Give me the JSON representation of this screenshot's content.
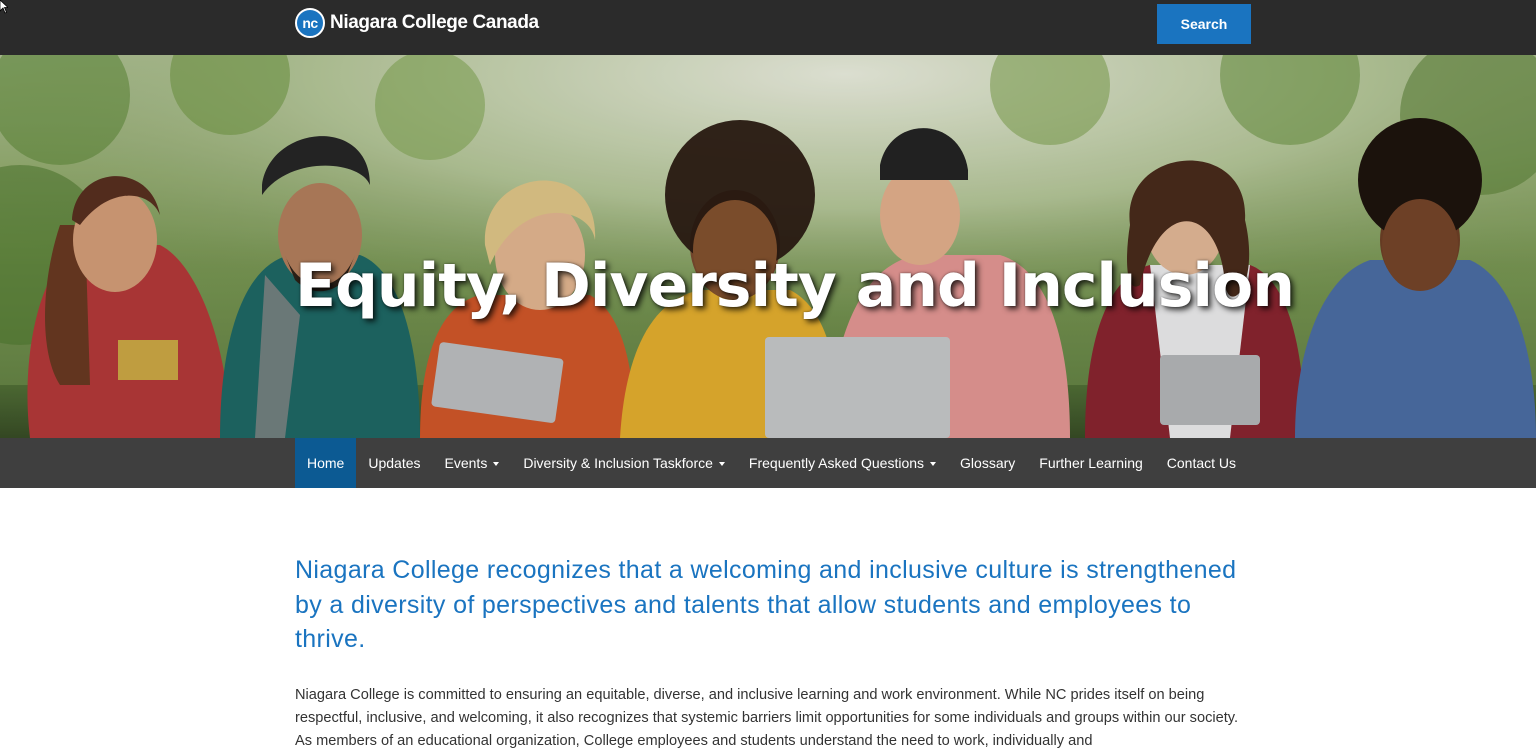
{
  "header": {
    "logo_badge": "nc",
    "logo_text": "Niagara College Canada",
    "search_label": "Search"
  },
  "hero": {
    "title": "Equity, Diversity and Inclusion"
  },
  "nav": {
    "items": [
      {
        "label": "Home",
        "active": true,
        "dropdown": false
      },
      {
        "label": "Updates",
        "active": false,
        "dropdown": false
      },
      {
        "label": "Events",
        "active": false,
        "dropdown": true
      },
      {
        "label": "Diversity & Inclusion Taskforce",
        "active": false,
        "dropdown": true
      },
      {
        "label": "Frequently Asked Questions",
        "active": false,
        "dropdown": true
      },
      {
        "label": "Glossary",
        "active": false,
        "dropdown": false
      },
      {
        "label": "Further Learning",
        "active": false,
        "dropdown": false
      },
      {
        "label": "Contact Us",
        "active": false,
        "dropdown": false
      }
    ]
  },
  "main": {
    "lead": "Niagara College recognizes that a welcoming and inclusive culture is strengthened by a diversity of perspectives and talents that allow students and employees to thrive.",
    "body": "Niagara College is committed to ensuring an equitable, diverse, and inclusive learning and work environment. While NC prides itself on being respectful, inclusive, and welcoming, it also recognizes that systemic barriers limit opportunities for some individuals and groups within our society. As members of an educational organization, College employees and students understand the need to work, individually and"
  },
  "colors": {
    "topbar": "#2b2b2b",
    "brand_blue": "#1a74c0",
    "nav_bg": "#3f3f3f",
    "nav_active": "#0c5a93",
    "body_text": "#333333"
  },
  "icons": {
    "cursor": "mouse-pointer-icon",
    "caret": "caret-down-icon"
  }
}
